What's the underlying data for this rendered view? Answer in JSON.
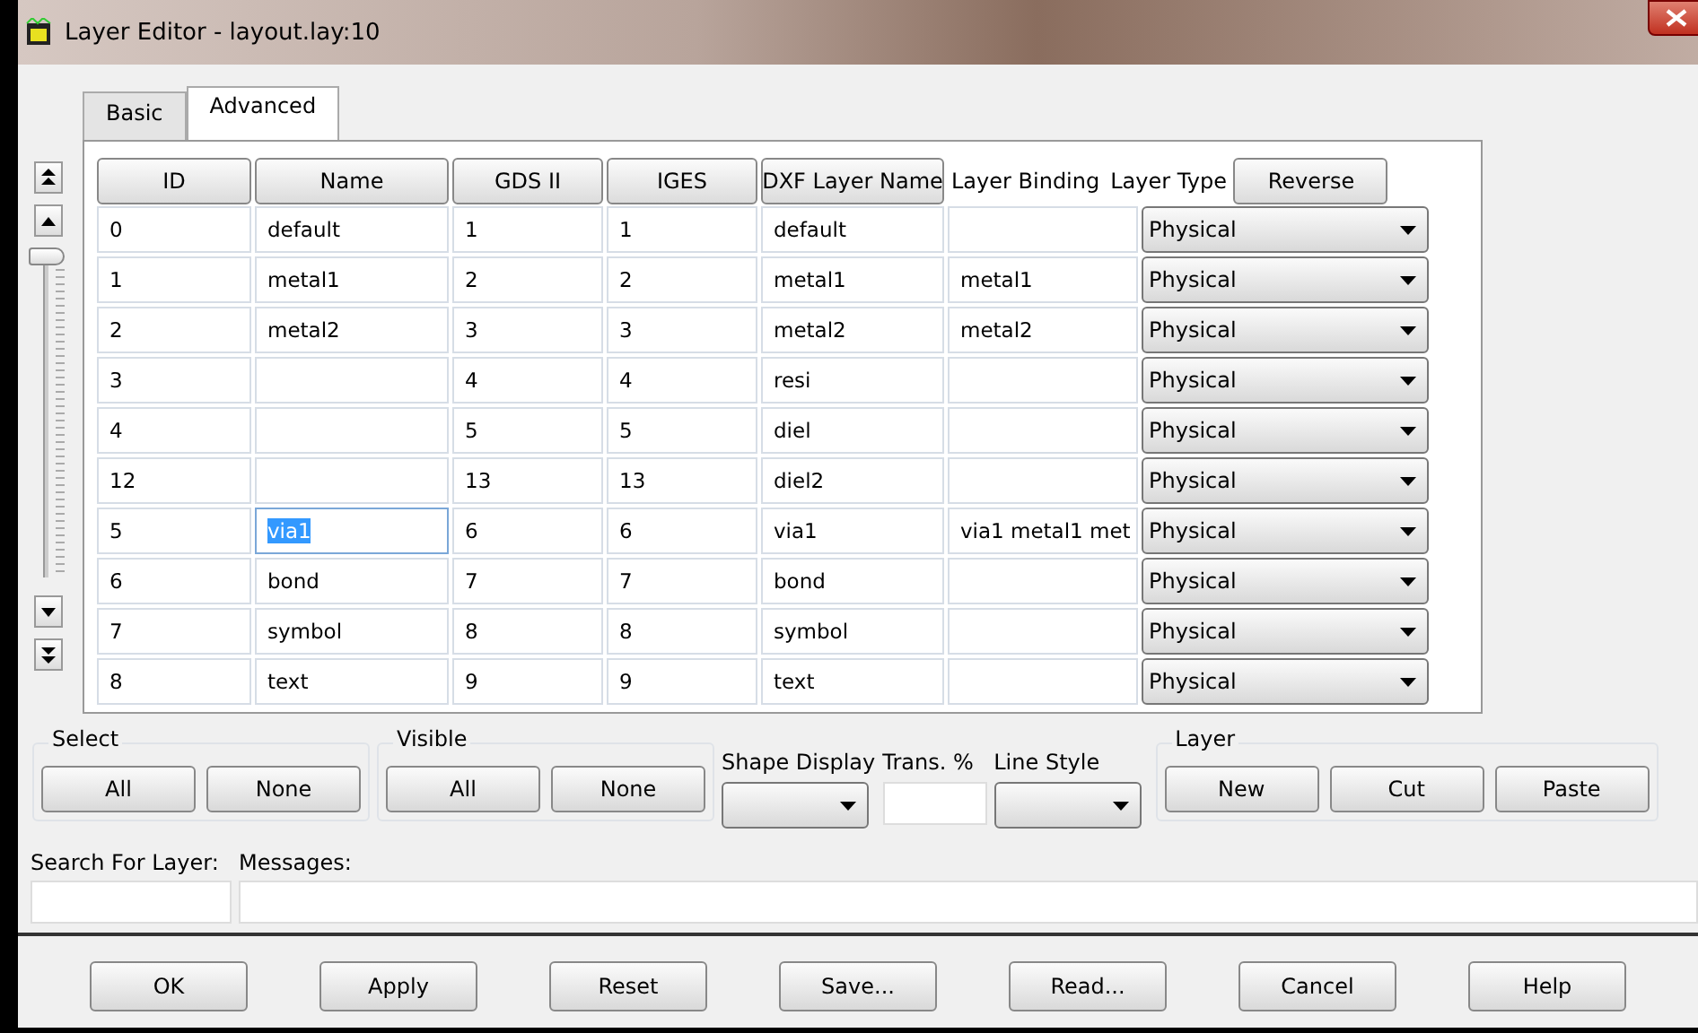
{
  "window": {
    "title": "Layer Editor - layout.lay:10"
  },
  "tabs": [
    {
      "label": "Basic",
      "selected": false
    },
    {
      "label": "Advanced",
      "selected": true
    }
  ],
  "table": {
    "columns": [
      {
        "label": "ID",
        "kind": "button"
      },
      {
        "label": "Name",
        "kind": "button"
      },
      {
        "label": "GDS II",
        "kind": "button"
      },
      {
        "label": "IGES",
        "kind": "button"
      },
      {
        "label": "DXF Layer Name",
        "kind": "button"
      },
      {
        "label": "Layer Binding",
        "kind": "text"
      },
      {
        "label": "Layer Type",
        "kind": "text"
      }
    ],
    "reverse_button": "Reverse",
    "rows": [
      {
        "id": "0",
        "name": "default",
        "gds": "1",
        "iges": "1",
        "dxf": "default",
        "binding": "",
        "type": "Physical",
        "editing": false
      },
      {
        "id": "1",
        "name": "metal1",
        "gds": "2",
        "iges": "2",
        "dxf": "metal1",
        "binding": "metal1",
        "type": "Physical",
        "editing": false
      },
      {
        "id": "2",
        "name": "metal2",
        "gds": "3",
        "iges": "3",
        "dxf": "metal2",
        "binding": "metal2",
        "type": "Physical",
        "editing": false
      },
      {
        "id": "3",
        "name": "",
        "gds": "4",
        "iges": "4",
        "dxf": "resi",
        "binding": "",
        "type": "Physical",
        "editing": false
      },
      {
        "id": "4",
        "name": "",
        "gds": "5",
        "iges": "5",
        "dxf": "diel",
        "binding": "",
        "type": "Physical",
        "editing": false
      },
      {
        "id": "12",
        "name": "",
        "gds": "13",
        "iges": "13",
        "dxf": "diel2",
        "binding": "",
        "type": "Physical",
        "editing": false
      },
      {
        "id": "5",
        "name": "via1",
        "gds": "6",
        "iges": "6",
        "dxf": "via1",
        "binding": "via1 metal1 met",
        "type": "Physical",
        "editing": true
      },
      {
        "id": "6",
        "name": "bond",
        "gds": "7",
        "iges": "7",
        "dxf": "bond",
        "binding": "",
        "type": "Physical",
        "editing": false
      },
      {
        "id": "7",
        "name": "symbol",
        "gds": "8",
        "iges": "8",
        "dxf": "symbol",
        "binding": "",
        "type": "Physical",
        "editing": false
      },
      {
        "id": "8",
        "name": "text",
        "gds": "9",
        "iges": "9",
        "dxf": "text",
        "binding": "",
        "type": "Physical",
        "editing": false
      }
    ]
  },
  "scroll_slider": {
    "level": 0
  },
  "select_group": {
    "title": "Select",
    "buttons": [
      "All",
      "None"
    ]
  },
  "visible_group": {
    "title": "Visible",
    "buttons": [
      "All",
      "None"
    ]
  },
  "shape_display": {
    "label": "Shape Display"
  },
  "trans": {
    "label": "Trans. %"
  },
  "line_style": {
    "label": "Line Style"
  },
  "layer_group": {
    "title": "Layer",
    "buttons": [
      "New",
      "Cut",
      "Paste"
    ]
  },
  "search": {
    "label": "Search For Layer:"
  },
  "messages": {
    "label": "Messages:"
  },
  "buttons": [
    "OK",
    "Apply",
    "Reset",
    "Save...",
    "Read...",
    "Cancel",
    "Help"
  ]
}
